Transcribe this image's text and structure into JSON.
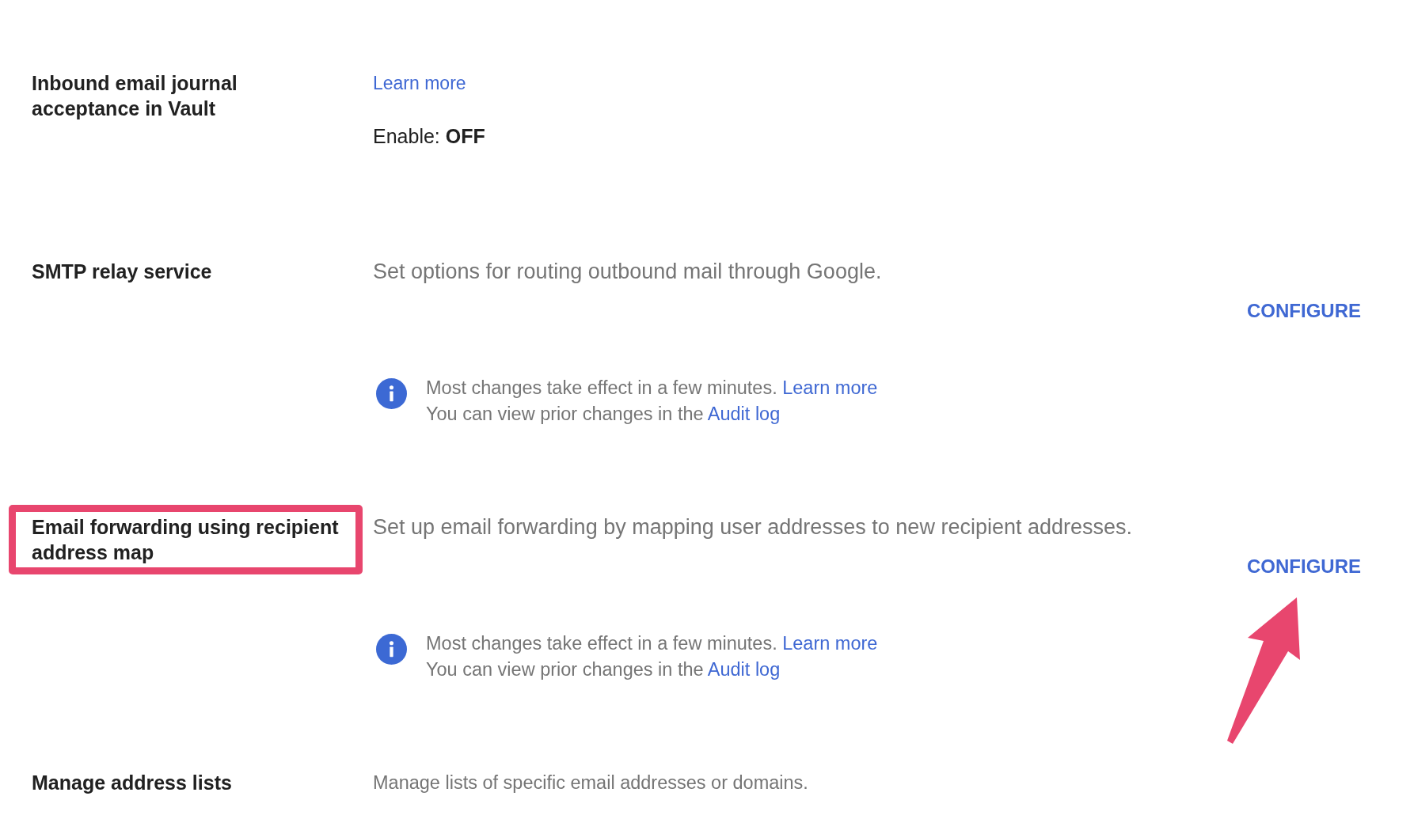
{
  "settings": [
    {
      "kind": "toggle",
      "title": "Inbound email journal acceptance in Vault",
      "highlighted": false,
      "annotation_arrow": false,
      "learn_more_link": "Learn more",
      "status": "Enable: **OFF**"
    },
    {
      "kind": "configurable",
      "title": "SMTP relay service",
      "highlighted": false,
      "annotation_arrow": false,
      "description": "Set options for routing outbound mail through Google.",
      "configure_button": "CONFIGURE",
      "note_lines": [
        {
          "text": "Most changes take effect in a few minutes.",
          "link": "Learn more"
        },
        {
          "text": "You can view prior changes in the",
          "link": "Audit log"
        }
      ]
    },
    {
      "kind": "configurable",
      "title": "Email forwarding using recipient address map",
      "highlighted": true,
      "annotation_arrow": true,
      "description": "Set up email forwarding by mapping user addresses to new recipient addresses.",
      "configure_button": "CONFIGURE",
      "note_lines": [
        {
          "text": "Most changes take effect in a few minutes.",
          "link": "Learn more"
        },
        {
          "text": "You can view prior changes in the",
          "link": "Audit log"
        }
      ]
    },
    {
      "kind": "list",
      "title": "Manage address lists",
      "highlighted": false,
      "annotation_arrow": false,
      "description": "Manage lists of specific email addresses or domains."
    }
  ]
}
